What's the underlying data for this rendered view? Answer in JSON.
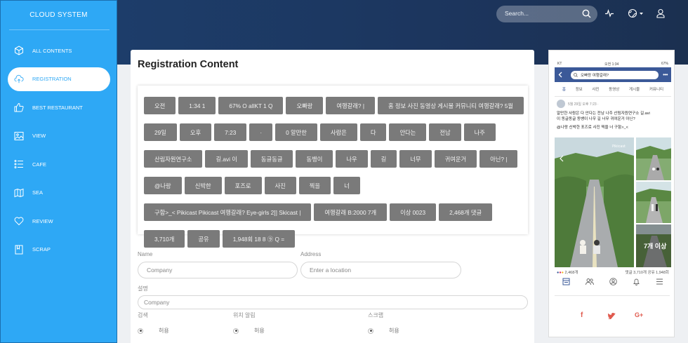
{
  "sidebar": {
    "brand": "CLOUD SYSTEM",
    "items": [
      {
        "label": "ALL CONTENTS",
        "icon": "cube-icon"
      },
      {
        "label": "REGISTRATION",
        "icon": "cloud-upload-icon",
        "active": true
      },
      {
        "label": "BEST RESTAURANT",
        "icon": "thumbs-up-icon"
      },
      {
        "label": "VIEW",
        "icon": "image-icon"
      },
      {
        "label": "CAFE",
        "icon": "list-icon"
      },
      {
        "label": "SEA",
        "icon": "map-icon"
      },
      {
        "label": "REVIEW",
        "icon": "heart-icon"
      },
      {
        "label": "SCRAP",
        "icon": "bookmark-icon"
      }
    ]
  },
  "header": {
    "search_placeholder": "Search...",
    "icons": [
      "search-icon",
      "activity-icon",
      "globe-icon",
      "user-icon"
    ]
  },
  "main": {
    "title": "Registration Content",
    "tags": [
      "오전",
      "1:34 1",
      "67% O allKT 1 Q",
      "오빠랑",
      "여행갈래? |",
      "홈 정보 사진 동영상 게시물 커뮤니티 여행갈래? 5월",
      "29일",
      "오후",
      "7:23",
      "·",
      "0 알만한",
      "사람은",
      "다",
      "안다는",
      "전남",
      "나주",
      "산림자원연구소",
      "길.avi 이",
      "동글동글",
      "동뱅이",
      "나우",
      "길",
      "너무",
      "귀여운거",
      "아닌? |",
      "@나랑",
      "신박한",
      "포즈로",
      "사진",
      "찍을",
      "너",
      "구함>_< Pikicast Pikicast 여행갈래? Eye-girls 2]] Skicast |",
      "여행갈래 B:2000 7개",
      "이상 0023",
      "2,468개 댓글",
      "3,710개",
      "공유",
      "1,948회 18 8 ⑨ Q ="
    ],
    "form": {
      "name_label": "Name",
      "name_placeholder": "Company",
      "address_label": "Address",
      "address_placeholder": "Enter a location",
      "desc_label": "설명",
      "desc_placeholder": "Company",
      "radios": [
        {
          "group": "검색",
          "option": "허용"
        },
        {
          "group": "위치 알림",
          "option": "허용"
        },
        {
          "group": "스크랩",
          "option": "허용"
        }
      ]
    }
  },
  "preview": {
    "status_left": "KT",
    "status_time": "오전 1:34",
    "status_right": "67%",
    "search_text": "오빠랑 여행갈래?",
    "tabs": [
      "홈",
      "정보",
      "사진",
      "동영상",
      "게시물",
      "커뮤니티"
    ],
    "post_date": "5월 29일 오후 7:23 · ",
    "post_line1": "알만한 사람은 다 안다는 전남 나주 산림자원연구소 길.avi",
    "post_line2": "이 동글동글 동뱅이 나우 길 너무 귀여운거 아닌?",
    "post_line3": "@나랑 신박한 포즈로 사진 찍을 너 구함>_<",
    "photo_watermark": "Pikicast",
    "more_photos": "7개 이상",
    "reactions": "2,468개",
    "comments_shares": "댓글 3,710개  공유 1,948회",
    "social": {
      "facebook": "f",
      "twitter": "twitter-icon",
      "google": "G+"
    },
    "colors": {
      "facebook": "#e05a4e",
      "twitter": "#e05a4e",
      "google": "#e05a4e",
      "fb_blue": "#3b5998"
    }
  }
}
